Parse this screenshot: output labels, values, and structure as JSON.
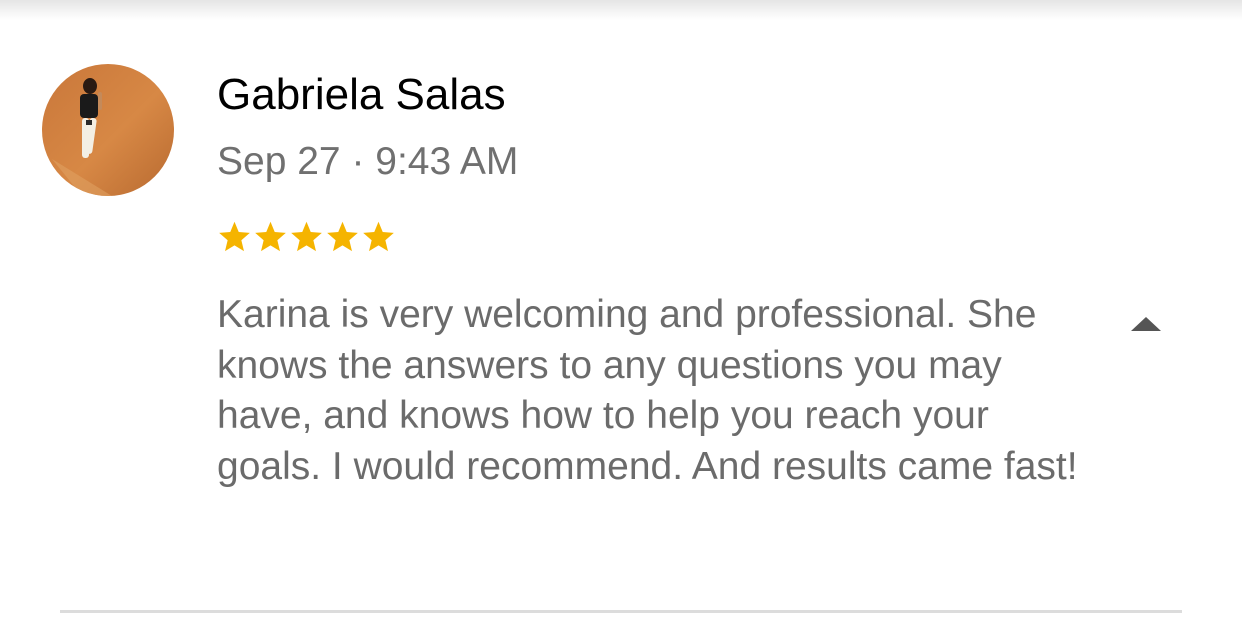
{
  "review": {
    "author": "Gabriela Salas",
    "date": "Sep 27 · 9:43 AM",
    "rating": 5,
    "rating_max": 5,
    "text": "Karina is very welcoming and professional. She knows the answers to any questions you may have, and knows how to help you reach your goals. I would recommend. And results came fast!",
    "collapse_icon": "caret-up-icon"
  },
  "colors": {
    "star": "#F5B400",
    "author": "#000000",
    "meta": "#707070",
    "body": "#6B6B6B",
    "icon": "#555555",
    "divider": "#DCDCDC"
  }
}
